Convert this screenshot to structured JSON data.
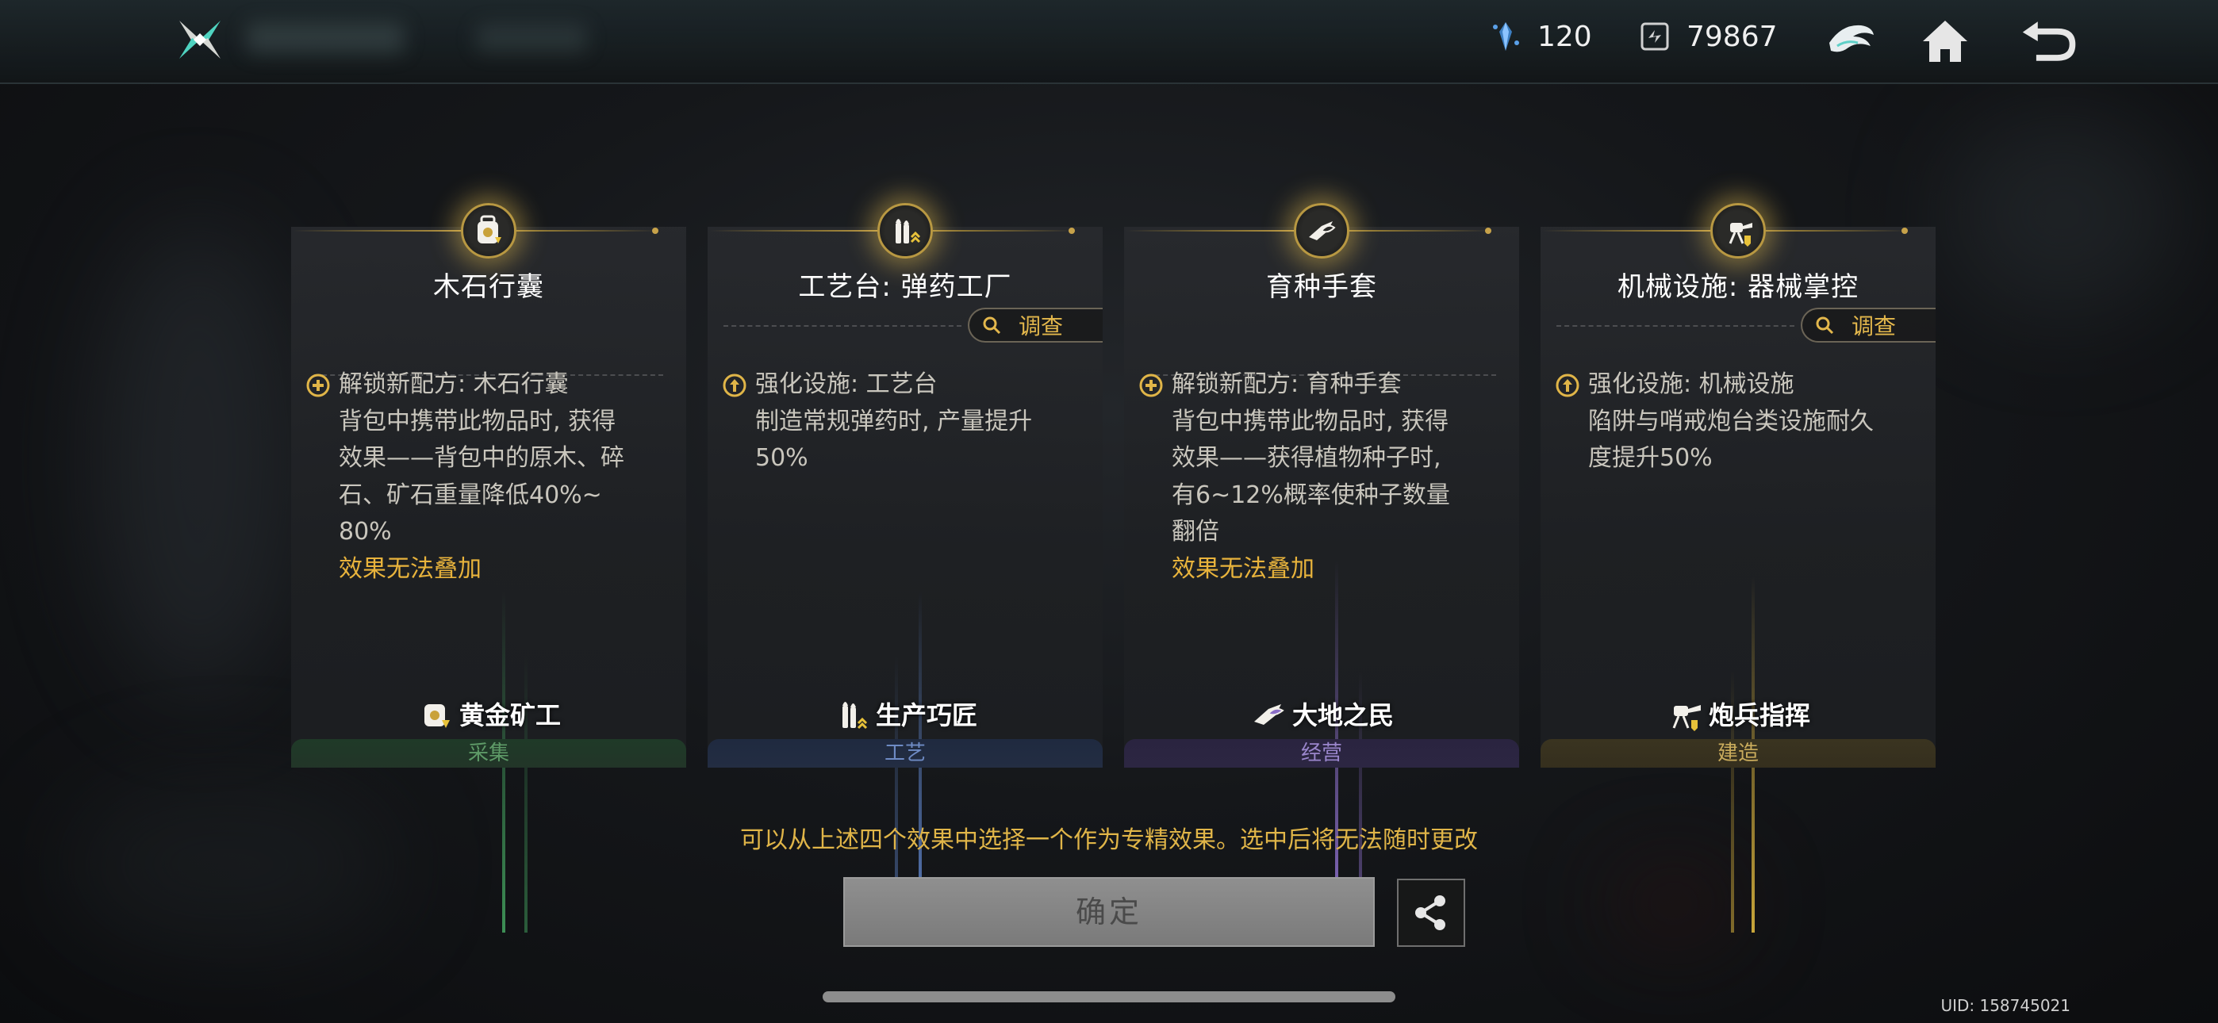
{
  "topbar": {
    "currency1_value": "120",
    "currency2_value": "79867"
  },
  "cards": [
    {
      "title": "木石行囊",
      "effect_lines": [
        "解锁新配方: 木石行囊",
        "背包中携带此物品时, 获得",
        "效果——背包中的原木、碎",
        "石、矿石重量降低40%~",
        "80%"
      ],
      "warning": "效果无法叠加",
      "talent": "黄金矿工",
      "category": "采集",
      "beam_color": "#3d8f55",
      "category_color": "#5e9a67",
      "category_bg": "#223528"
    },
    {
      "title": "工艺台: 弹药工厂",
      "investigate_label": "调查",
      "effect_lines": [
        "强化设施: 工艺台",
        "制造常规弹药时, 产量提升",
        "50%"
      ],
      "talent": "生产巧匠",
      "category": "工艺",
      "beam_color": "#5a7dbf",
      "category_color": "#6e8bc4",
      "category_bg": "#232d42"
    },
    {
      "title": "育种手套",
      "effect_lines": [
        "解锁新配方: 育种手套",
        "背包中携带此物品时, 获得",
        "效果——获得植物种子时,",
        "有6~12%概率使种子数量",
        "翻倍"
      ],
      "warning": "效果无法叠加",
      "talent": "大地之民",
      "category": "经营",
      "beam_color": "#8a6dc7",
      "category_color": "#9a86cc",
      "category_bg": "#2c2642"
    },
    {
      "title": "机械设施: 器械掌控",
      "investigate_label": "调查",
      "effect_lines": [
        "强化设施: 机械设施",
        "陷阱与哨戒炮台类设施耐久",
        "度提升50%"
      ],
      "talent": "炮兵指挥",
      "category": "建造",
      "beam_color": "#c9a63a",
      "category_color": "#c9ab5c",
      "category_bg": "#3a3420"
    }
  ],
  "hint": "可以从上述四个效果中选择一个作为专精效果。选中后将无法随时更改",
  "confirm_label": "确定",
  "uid": "UID: 158745021",
  "colors": {
    "accent_gold": "#e0b548",
    "confirm_disabled": "#858585"
  },
  "icons": [
    "crossed-swords-logo-icon",
    "crystal-currency-icon",
    "chip-currency-icon",
    "guild-emblem-icon",
    "home-icon",
    "back-arrow-icon",
    "share-icon",
    "search-icon"
  ]
}
